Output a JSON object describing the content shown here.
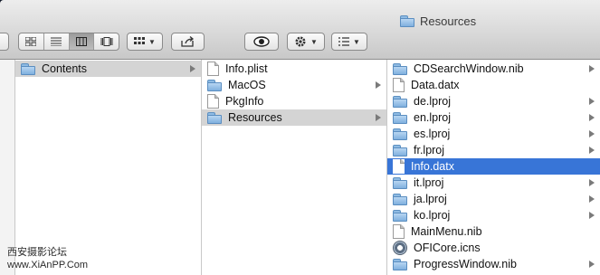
{
  "window": {
    "title": "Resources"
  },
  "toolbar": {
    "view_modes": [
      "icon-view",
      "list-view",
      "column-view",
      "cover-flow-view"
    ],
    "selected_view": "column-view",
    "arrange_icon": "grid-arrange-icon",
    "share_icon": "share-icon",
    "quicklook_icon": "eye-icon",
    "action_icon": "gear-icon",
    "path_icon": "list-icon"
  },
  "columns": {
    "col1": [
      {
        "label": "Contents",
        "icon": "folder",
        "has_children": true,
        "state": "selected-inactive"
      }
    ],
    "col2": [
      {
        "label": "Info.plist",
        "icon": "document",
        "has_children": false,
        "state": ""
      },
      {
        "label": "MacOS",
        "icon": "folder",
        "has_children": true,
        "state": ""
      },
      {
        "label": "PkgInfo",
        "icon": "document",
        "has_children": false,
        "state": ""
      },
      {
        "label": "Resources",
        "icon": "folder",
        "has_children": true,
        "state": "selected-inactive"
      }
    ],
    "col3": [
      {
        "label": "CDSearchWindow.nib",
        "icon": "folder",
        "has_children": true,
        "state": ""
      },
      {
        "label": "Data.datx",
        "icon": "document",
        "has_children": false,
        "state": ""
      },
      {
        "label": "de.lproj",
        "icon": "folder",
        "has_children": true,
        "state": ""
      },
      {
        "label": "en.lproj",
        "icon": "folder",
        "has_children": true,
        "state": ""
      },
      {
        "label": "es.lproj",
        "icon": "folder",
        "has_children": true,
        "state": ""
      },
      {
        "label": "fr.lproj",
        "icon": "folder",
        "has_children": true,
        "state": ""
      },
      {
        "label": "Info.datx",
        "icon": "document",
        "has_children": false,
        "state": "selected-active"
      },
      {
        "label": "it.lproj",
        "icon": "folder",
        "has_children": true,
        "state": ""
      },
      {
        "label": "ja.lproj",
        "icon": "folder",
        "has_children": true,
        "state": ""
      },
      {
        "label": "ko.lproj",
        "icon": "folder",
        "has_children": true,
        "state": ""
      },
      {
        "label": "MainMenu.nib",
        "icon": "document",
        "has_children": false,
        "state": ""
      },
      {
        "label": "OFICore.icns",
        "icon": "icns-file",
        "has_children": false,
        "state": ""
      },
      {
        "label": "ProgressWindow.nib",
        "icon": "folder",
        "has_children": true,
        "state": ""
      }
    ]
  },
  "watermark": {
    "line1": "西安摄影论坛",
    "line2": "www.XiAnPP.Com"
  },
  "colors": {
    "selection_active": "#3875d7",
    "selection_inactive": "#d4d4d4"
  }
}
